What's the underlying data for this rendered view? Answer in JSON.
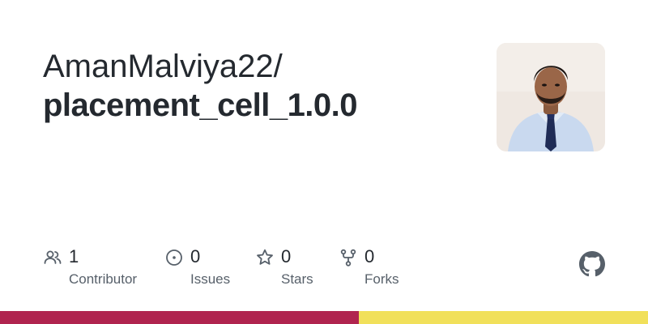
{
  "header": {
    "owner": "AmanMalviya22/",
    "repo_name": "placement_cell_1.0.0"
  },
  "avatar": {
    "icon": "user-avatar"
  },
  "stats": [
    {
      "icon": "people-icon",
      "value": "1",
      "label": "Contributor"
    },
    {
      "icon": "issue-opened-icon",
      "value": "0",
      "label": "Issues"
    },
    {
      "icon": "star-icon",
      "value": "0",
      "label": "Stars"
    },
    {
      "icon": "repo-forked-icon",
      "value": "0",
      "label": "Forks"
    }
  ],
  "footer": {
    "logo": "github-logo-icon",
    "language_colors": [
      "#b0244f",
      "#f1e05a"
    ]
  },
  "colors": {
    "text_primary": "#24292f",
    "text_secondary": "#57606a",
    "icon": "#57606a"
  }
}
